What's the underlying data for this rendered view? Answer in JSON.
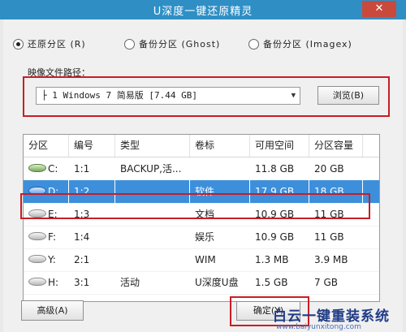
{
  "window": {
    "title": "U深度一键还原精灵",
    "close_label": "✕"
  },
  "mode_options": [
    {
      "label": "还原分区 (R)",
      "selected": true
    },
    {
      "label": "备份分区 (Ghost)",
      "selected": false
    },
    {
      "label": "备份分区 (Imagex)",
      "selected": false
    }
  ],
  "image_path": {
    "label": "映像文件路径：",
    "value": "├ 1 Windows 7 简易版 [7.44 GB]",
    "browse_label": "浏览(B)",
    "dropdown_icon": "chevron-down-icon"
  },
  "table": {
    "columns": [
      "分区",
      "编号",
      "类型",
      "卷标",
      "可用空间",
      "分区容量"
    ],
    "rows": [
      {
        "drive": "C:",
        "id": "1:1",
        "type": "BACKUP,活...",
        "label": "",
        "free": "11.8 GB",
        "size": "20 GB",
        "icon": "green-disk-icon",
        "selected": false
      },
      {
        "drive": "D:",
        "id": "1:2",
        "type": "",
        "label": "软件",
        "free": "17.9 GB",
        "size": "18 GB",
        "icon": "blue-disk-icon",
        "selected": true
      },
      {
        "drive": "E:",
        "id": "1:3",
        "type": "",
        "label": "文档",
        "free": "10.9 GB",
        "size": "11 GB",
        "icon": "disk-icon",
        "selected": false
      },
      {
        "drive": "F:",
        "id": "1:4",
        "type": "",
        "label": "娱乐",
        "free": "10.9 GB",
        "size": "11 GB",
        "icon": "disk-icon",
        "selected": false
      },
      {
        "drive": "Y:",
        "id": "2:1",
        "type": "",
        "label": "WIM",
        "free": "1.3 MB",
        "size": "3.9 MB",
        "icon": "disk-icon",
        "selected": false
      },
      {
        "drive": "H:",
        "id": "3:1",
        "type": "活动",
        "label": "U深度U盘",
        "free": "1.5 GB",
        "size": "7 GB",
        "icon": "disk-icon",
        "selected": false
      }
    ]
  },
  "buttons": {
    "advanced_label": "高级(A)",
    "ok_label": "确定(Y)"
  },
  "watermark": {
    "title": "白云一键重装系统",
    "url": "www.baiyunxitong.com"
  },
  "colors": {
    "titlebar": "#2f8fc5",
    "close": "#c94a3d",
    "selection": "#3d8fdb",
    "highlight": "#c81d25"
  }
}
